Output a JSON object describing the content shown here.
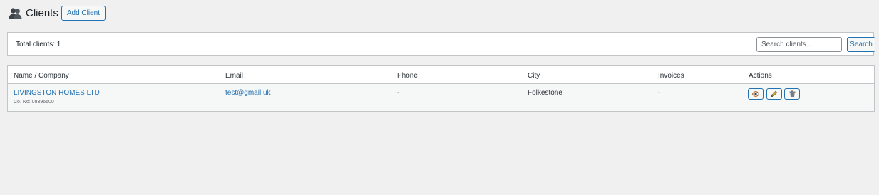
{
  "header": {
    "icon": "users-icon",
    "title": "Clients",
    "add_label": "Add Client"
  },
  "summary": {
    "total_text": "Total clients: 1",
    "search_placeholder": "Search clients...",
    "search_label": "Search"
  },
  "table": {
    "columns": [
      "Name / Company",
      "Email",
      "Phone",
      "City",
      "Invoices",
      "Actions"
    ],
    "rows": [
      {
        "name": "LIVINGSTON HOMES LTD",
        "company_no": "Co. No: 08396600",
        "email": "test@gmail.uk",
        "phone": "-",
        "city": "Folkestone",
        "invoices": "-",
        "actions": [
          "eye-icon",
          "pencil-icon",
          "trash-icon"
        ]
      }
    ]
  },
  "colors": {
    "accent": "#2271b1",
    "background": "#f0f0f1",
    "border": "#c3c4c7"
  }
}
